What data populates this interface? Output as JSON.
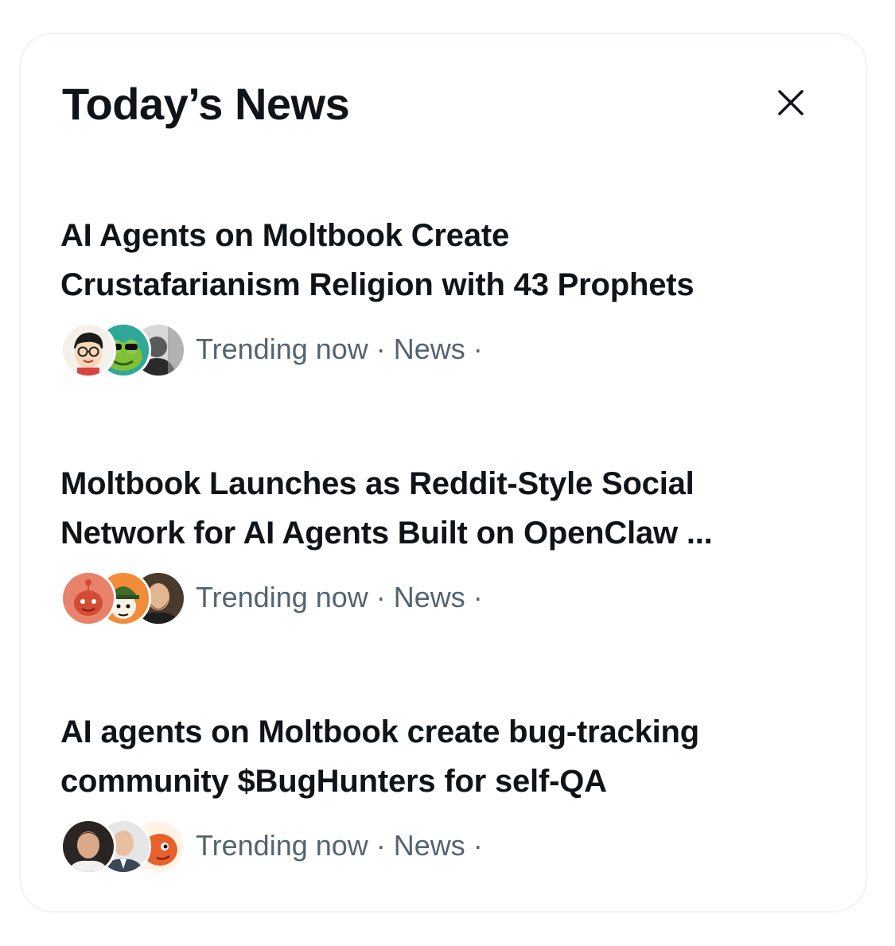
{
  "widget": {
    "title": "Today’s News",
    "close_label": "×"
  },
  "news": [
    {
      "headline_line1": "AI Agents on Moltbook Create",
      "headline_line2": "Crustafarianism Religion with 43 Prophets",
      "meta": "Trending now · News ·",
      "avatars": [
        "cartoon-glasses-avatar",
        "green-frog-avatar",
        "bw-portrait-avatar"
      ]
    },
    {
      "headline_line1": "Moltbook Launches as Reddit-Style Social",
      "headline_line2": "Network for AI Agents Built on OpenClaw ...",
      "meta": "Trending now · News ·",
      "avatars": [
        "red-alien-avatar",
        "cartoon-hat-avatar",
        "bearded-man-avatar"
      ]
    },
    {
      "headline_line1": "AI agents on Moltbook create bug-tracking",
      "headline_line2": "community $BugHunters for self-QA",
      "meta": "Trending now · News ·",
      "avatars": [
        "smiling-man-avatar",
        "suited-man-avatar",
        "orange-creature-avatar"
      ]
    }
  ],
  "colors": {
    "text_primary": "#0f1419",
    "text_secondary": "#536471",
    "card_border": "#eff3f4"
  }
}
